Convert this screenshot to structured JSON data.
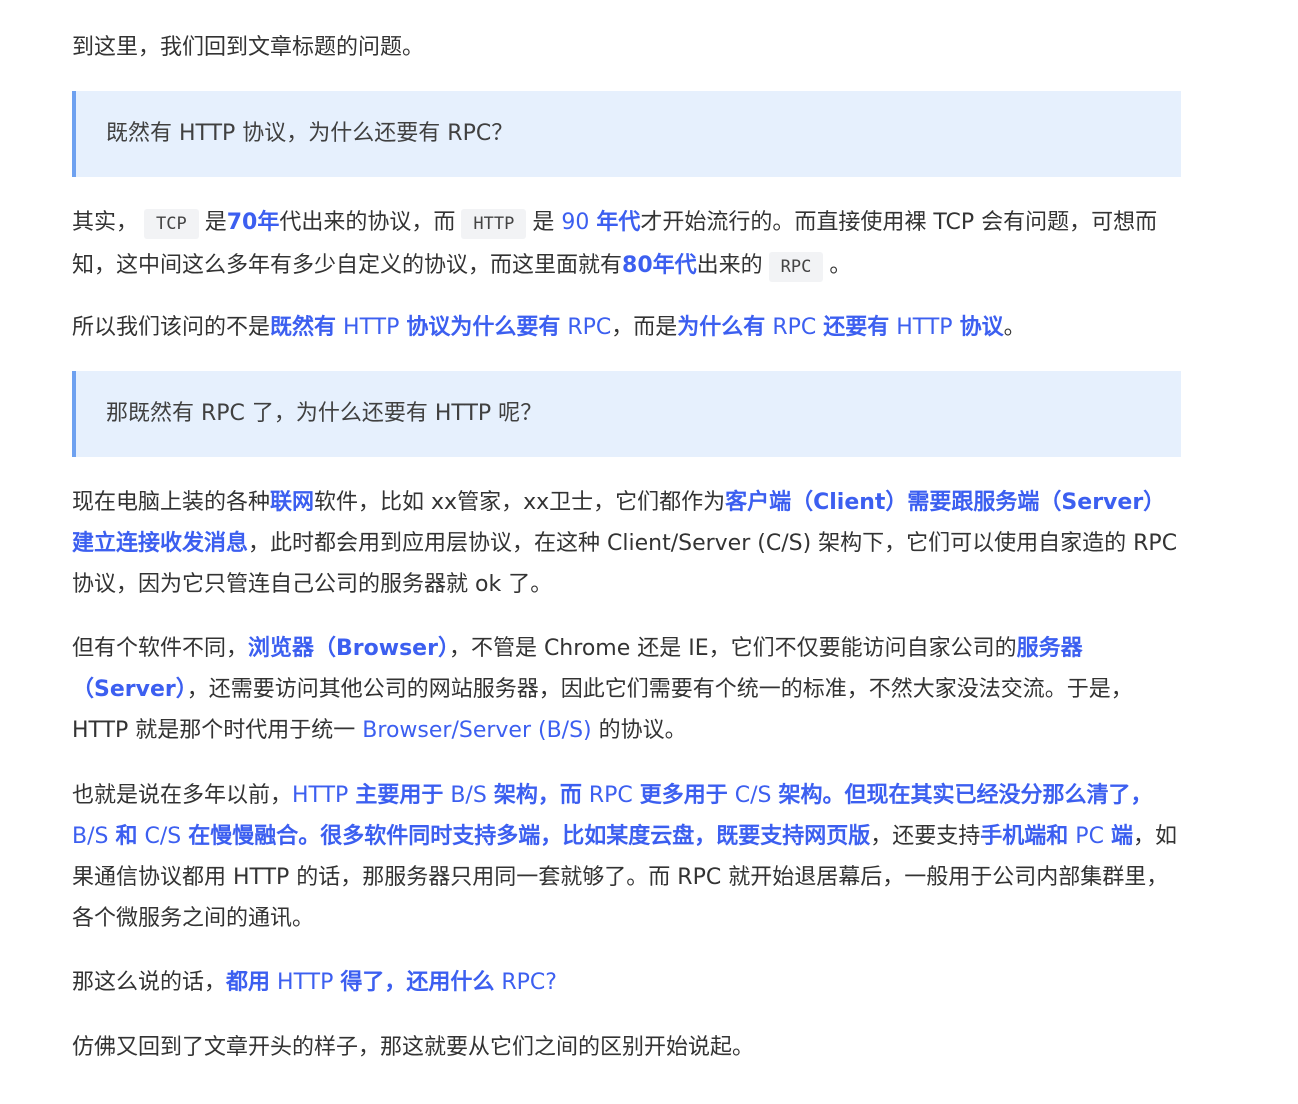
{
  "article": {
    "intro": "到这里，我们回到文章标题的问题。",
    "quote1": "既然有 HTTP 协议，为什么还要有 RPC？",
    "para2": {
      "t1": "其实，",
      "code_tcp": "TCP",
      "t2": "是",
      "b1": "70年",
      "t3": "代出来的协议，而",
      "code_http": "HTTP",
      "t4": "是",
      "h1": "90",
      "b2": "年代",
      "t5": "才开始流行的。而直接使用裸 TCP 会有问题，可想而知，这中间这么多年有多少自定义的协议，而这里面就有",
      "b3": "80年代",
      "t6": "出来的",
      "code_rpc": "RPC",
      "t7": "。"
    },
    "para3": {
      "t1": "所以我们该问的不是",
      "b1": "既然有",
      "h1": "HTTP",
      "b2": "协议为什么要有",
      "h2": "RPC",
      "t2": "，而是",
      "b3": "为什么有",
      "h3": "RPC",
      "b4": "还要有",
      "h4": "HTTP",
      "b5": "协议",
      "t3": "。"
    },
    "quote2": "那既然有 RPC 了，为什么还要有 HTTP 呢？",
    "para4": {
      "t1": "现在电脑上装的各种",
      "b1": "联网",
      "t2": "软件，比如 xx管家，xx卫士，它们都作为",
      "b2": "客户端（Client）需要跟服务端（Server）建立连接收发消息",
      "t3": "，此时都会用到应用层协议，在这种 Client/Server (C/S) 架构下，它们可以使用自家造的 RPC 协议，因为它只管连自己公司的服务器就 ok 了。"
    },
    "para5": {
      "t1": "但有个软件不同，",
      "b1": "浏览器（Browser）",
      "t2": "，不管是 Chrome 还是 IE，它们不仅要能访问自家公司的",
      "b2": "服务器（Server）",
      "t3": "，还需要访问其他公司的网站服务器，因此它们需要有个统一的标准，不然大家没法交流。于是，HTTP 就是那个时代用于统一",
      "h1": "Browser/Server (B/S)",
      "t4": "的协议。"
    },
    "para6": {
      "t1": "也就是说在多年以前，",
      "h1": "HTTP",
      "b1": "主要用于",
      "h2": "B/S",
      "b2": "架构，而",
      "h3": "RPC",
      "b3": "更多用于",
      "h4": "C/S",
      "b4": "架构。但现在其实已经没分那么清了，",
      "h5": "B/S",
      "b5": "和",
      "h6": "C/S",
      "b6": "在慢慢融合。很多软件同时支持多端，比如某度云盘，既要支持网页版",
      "t2": "，还要支持",
      "b7": "手机端和",
      "h7": "PC",
      "b8": "端",
      "t3": "，如果通信协议都用 HTTP 的话，那服务器只用同一套就够了。而 RPC 就开始退居幕后，一般用于公司内部集群里，各个微服务之间的通讯。"
    },
    "para7": {
      "t1": "那这么说的话，",
      "b1": "都用",
      "h1": "HTTP",
      "b2": "得了，还用什么",
      "h2": "RPC?"
    },
    "para8": "仿佛又回到了文章开头的样子，那这就要从它们之间的区别开始说起。"
  },
  "colors": {
    "text": "#333333",
    "highlight": "#3c5ff0",
    "quote_bg": "#e6f0fd",
    "quote_border": "#6ea1f0",
    "code_bg": "#f2f3f5"
  }
}
